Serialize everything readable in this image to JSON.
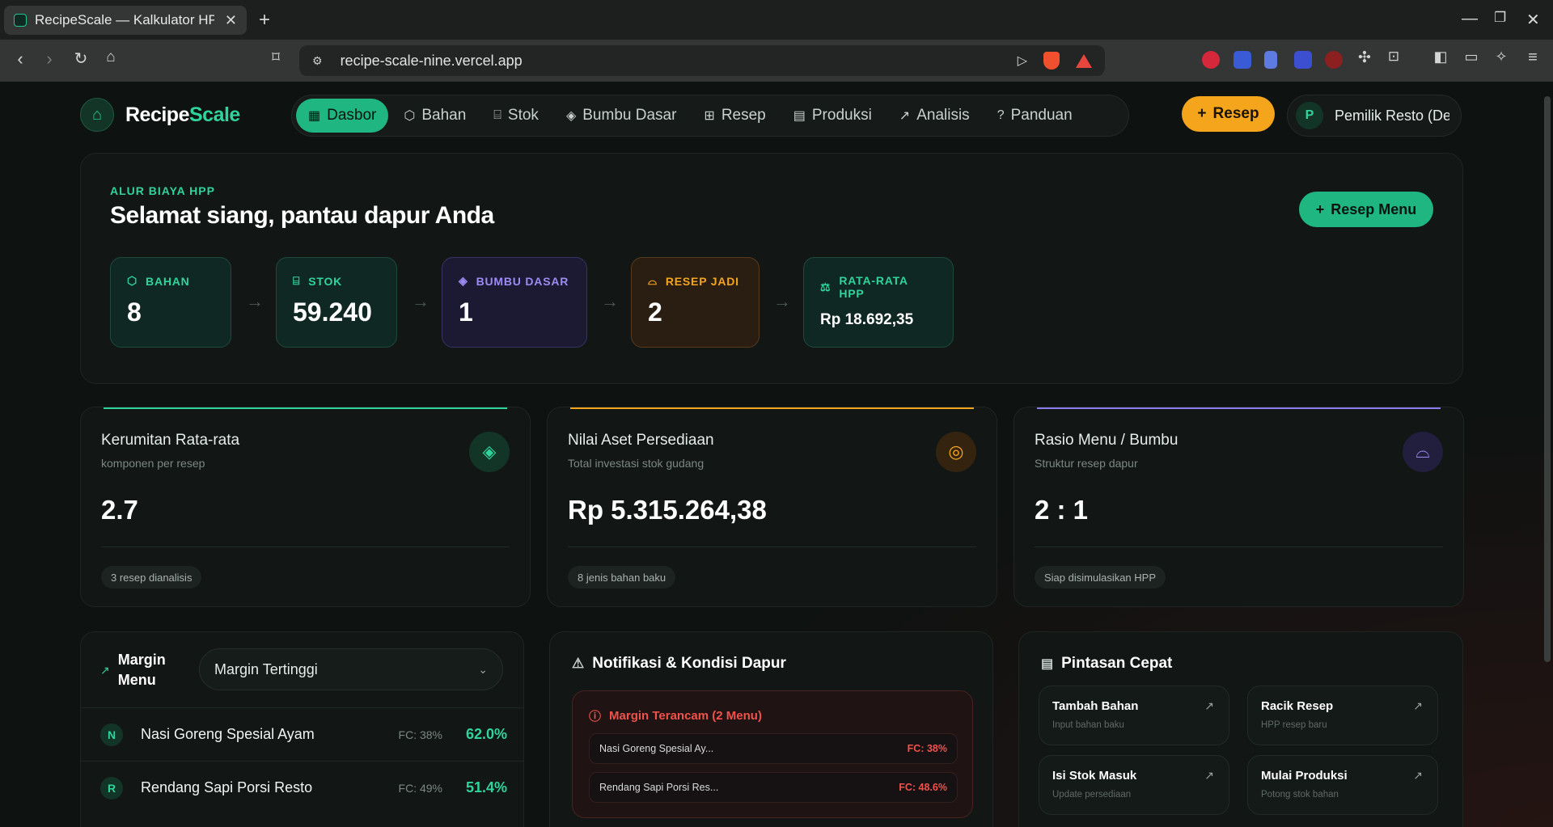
{
  "browser": {
    "tab_title": "RecipeScale — Kalkulator HPP",
    "url": "recipe-scale-nine.vercel.app"
  },
  "app": {
    "brand_main": "Recipe",
    "brand_accent": "Scale",
    "nav": [
      {
        "label": "Dasbor",
        "icon": "grid-icon",
        "active": true
      },
      {
        "label": "Bahan",
        "icon": "box-icon"
      },
      {
        "label": "Stok",
        "icon": "warehouse-icon"
      },
      {
        "label": "Bumbu Dasar",
        "icon": "layers-icon"
      },
      {
        "label": "Resep",
        "icon": "book-icon"
      },
      {
        "label": "Produksi",
        "icon": "clipboard-icon"
      },
      {
        "label": "Analisis",
        "icon": "trend-icon"
      },
      {
        "label": "Panduan",
        "icon": "help-icon"
      }
    ],
    "add_recipe_label": "Resep",
    "user_initial": "P",
    "user_name": "Pemilik Resto (Demo)"
  },
  "hero": {
    "eyebrow": "ALUR BIAYA HPP",
    "title": "Selamat siang, pantau dapur Anda",
    "cta_label": "Resep Menu",
    "flow": [
      {
        "label": "BAHAN",
        "value": "8",
        "icon": "box-icon",
        "tone": "green"
      },
      {
        "label": "STOK",
        "value": "59.240",
        "icon": "warehouse-icon",
        "tone": "green"
      },
      {
        "label": "BUMBU DASAR",
        "value": "1",
        "icon": "layers-icon",
        "tone": "purple"
      },
      {
        "label": "RESEP JADI",
        "value": "2",
        "icon": "chef-hat-icon",
        "tone": "orange"
      },
      {
        "label": "RATA-RATA HPP",
        "value": "Rp 18.692,35",
        "icon": "scale-icon",
        "tone": "green"
      }
    ]
  },
  "stats": [
    {
      "title": "Kerumitan Rata-rata",
      "subtitle": "komponen per resep",
      "value": "2.7",
      "chip": "3 resep dianalisis",
      "icon": "layers-icon",
      "color": "#2fd49c"
    },
    {
      "title": "Nilai Aset Persediaan",
      "subtitle": "Total investasi stok gudang",
      "value": "Rp 5.315.264,38",
      "chip": "8 jenis bahan baku",
      "icon": "coins-icon",
      "color": "#f5a51c"
    },
    {
      "title": "Rasio Menu / Bumbu",
      "subtitle": "Struktur resep dapur",
      "value": "2 : 1",
      "chip": "Siap disimulasikan HPP",
      "icon": "chef-hat-icon",
      "color": "#8b7cf0"
    }
  ],
  "margin": {
    "title": "Margin Menu",
    "select_value": "Margin Tertinggi",
    "rows": [
      {
        "initial": "N",
        "name": "Nasi Goreng Spesial Ayam",
        "fc": "FC: 38%",
        "margin": "62.0%"
      },
      {
        "initial": "R",
        "name": "Rendang Sapi Porsi Resto",
        "fc": "FC: 49%",
        "margin": "51.4%"
      }
    ]
  },
  "notifications": {
    "title": "Notifikasi & Kondisi Dapur",
    "alert_title": "Margin Terancam (2 Menu)",
    "items": [
      {
        "name": "Nasi Goreng Spesial Ay...",
        "fc": "FC: 38%"
      },
      {
        "name": "Rendang Sapi Porsi Res...",
        "fc": "FC: 48.6%"
      }
    ]
  },
  "shortcuts": {
    "title": "Pintasan Cepat",
    "items": [
      {
        "title": "Tambah Bahan",
        "subtitle": "Input bahan baku"
      },
      {
        "title": "Racik Resep",
        "subtitle": "HPP resep baru"
      },
      {
        "title": "Isi Stok Masuk",
        "subtitle": "Update persediaan"
      },
      {
        "title": "Mulai Produksi",
        "subtitle": "Potong stok bahan"
      }
    ]
  }
}
